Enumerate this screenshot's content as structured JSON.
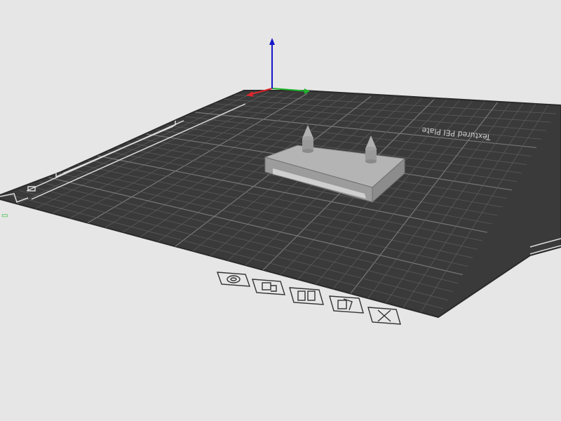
{
  "app": {
    "name": "3D print slicer viewport"
  },
  "plate": {
    "label": "Textured PEI Plate",
    "colors": {
      "bed": "#3a3a3a",
      "grid_minor": "#5a5a5a",
      "grid_major": "#777777",
      "edge": "#2a2a2a",
      "background": "#e6e6e6"
    }
  },
  "axes": {
    "colors": {
      "x": "#e0262b",
      "y": "#21b52c",
      "z": "#1616c8"
    }
  },
  "model": {
    "color": "#a9a9a9"
  },
  "plate_toolbar": {
    "icons": [
      "orient-icon",
      "arrange-icon",
      "slice-plate-icon",
      "settings-icon",
      "delete-plate-icon"
    ]
  }
}
